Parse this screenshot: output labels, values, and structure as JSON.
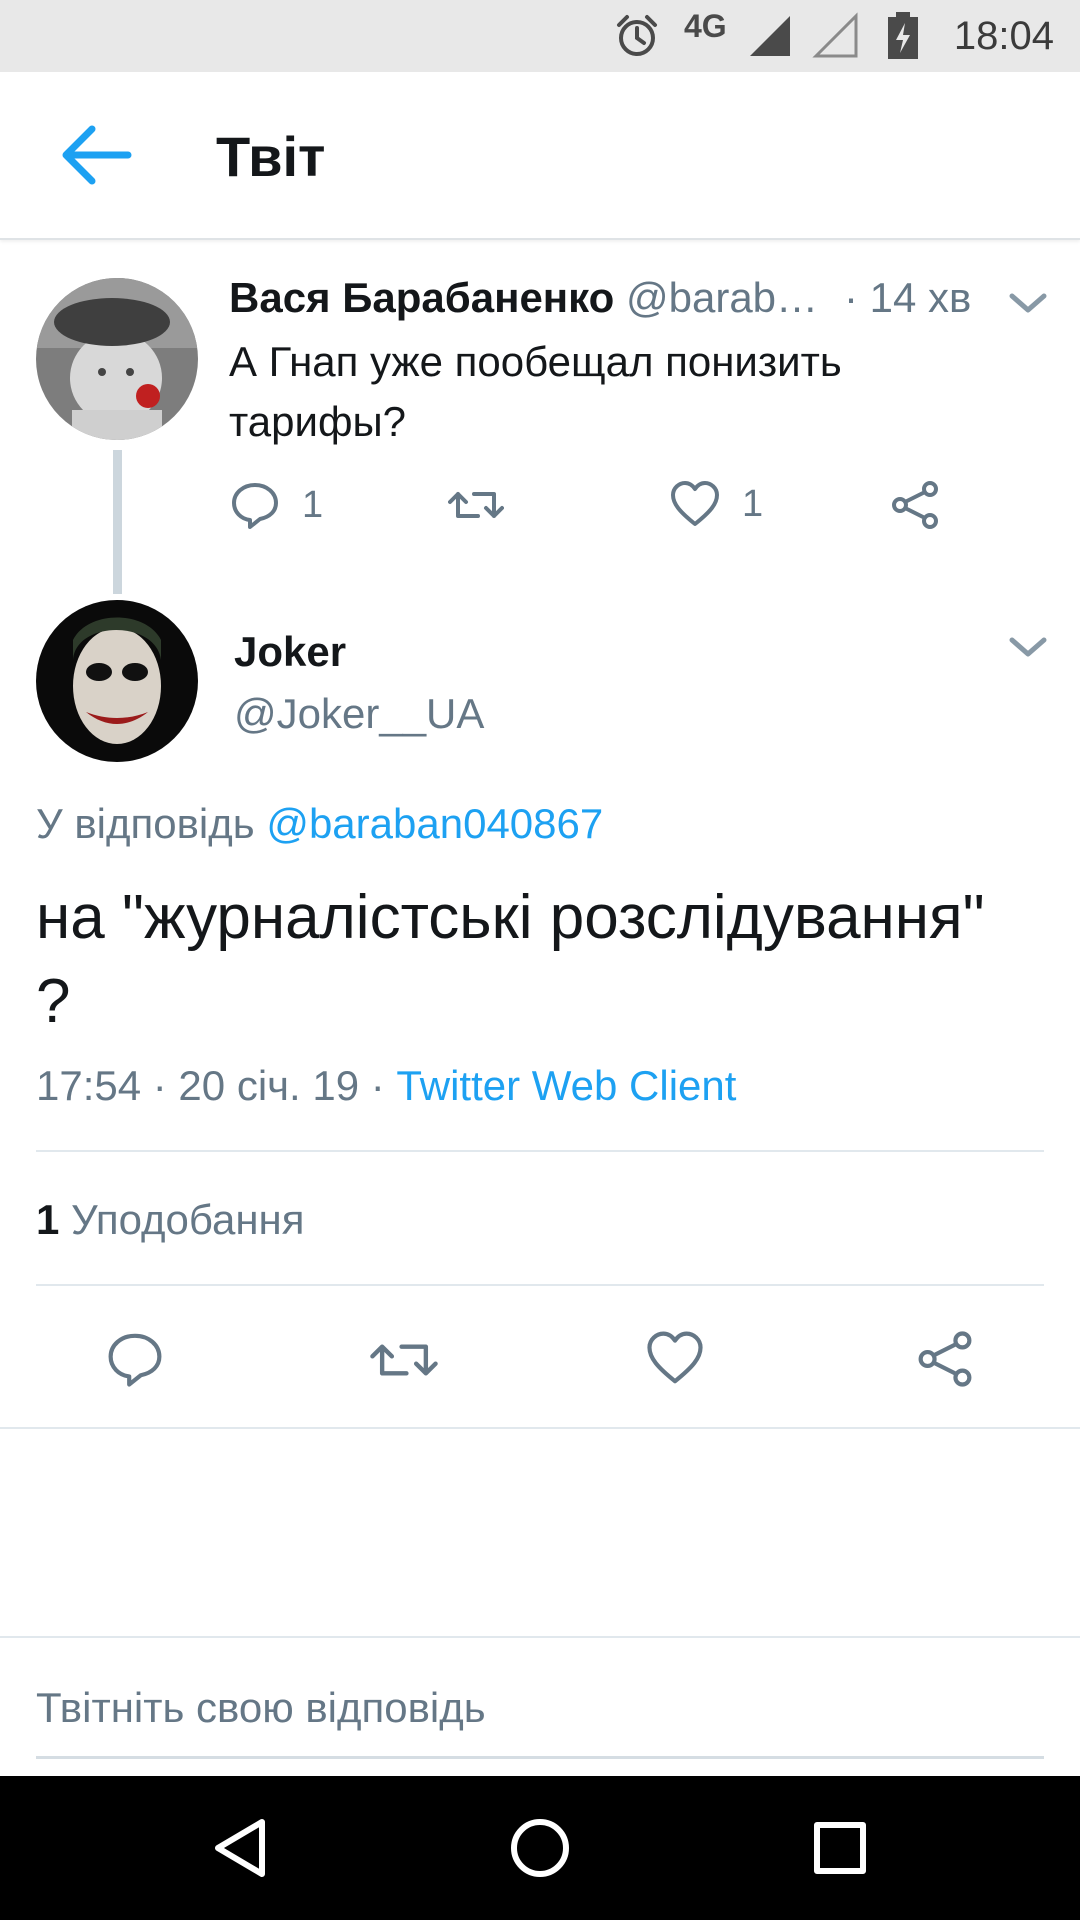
{
  "status_bar": {
    "network": "4G",
    "time": "18:04",
    "icons": [
      "alarm-icon",
      "signal-icon",
      "signal-empty-icon",
      "battery-charging-icon"
    ]
  },
  "app_bar": {
    "title": "Твіт",
    "back_icon": "arrow-left-icon"
  },
  "parent_tweet": {
    "name": "Вася Барабаненко",
    "handle": "@barab…",
    "time": "· 14 хв",
    "text": "А Гнап уже пообещал понизить тарифы?",
    "reply_count": "1",
    "like_count": "1",
    "icons": [
      "reply-icon",
      "retweet-icon",
      "like-icon",
      "share-icon",
      "chevron-down-icon"
    ]
  },
  "main_tweet": {
    "name": "Joker",
    "handle": "@Joker__UA",
    "reply_prefix": "У відповідь",
    "reply_mention": "@baraban040867",
    "text": "на \"журналістські розслідування\" ?",
    "time": "17:54 · 20 січ. 19 ·",
    "source": "Twitter Web Client",
    "like_count": "1",
    "like_label": "Уподобання",
    "icons": [
      "reply-icon",
      "retweet-icon",
      "like-icon",
      "share-icon",
      "chevron-down-icon"
    ]
  },
  "composer": {
    "placeholder": "Твітніть свою відповідь"
  },
  "nav_bar": {
    "icons": [
      "back-triangle-icon",
      "home-circle-icon",
      "recents-square-icon"
    ]
  },
  "colors": {
    "accent": "#1da1f2",
    "secondary_text": "#657786",
    "primary_text": "#14171a",
    "status_bar_bg": "#e8e8e8",
    "nav_bar_bg": "#000000"
  }
}
